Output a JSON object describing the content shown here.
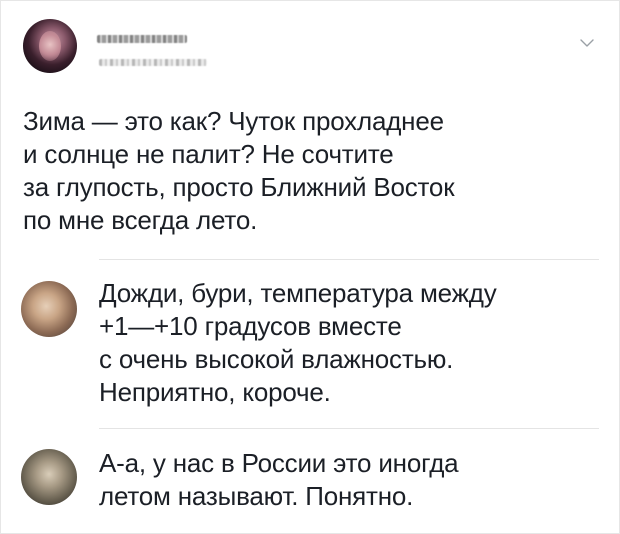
{
  "post": {
    "text": "Зима — это как? Чуток прохладнее\nи солнце не палит? Не сочтите\nза глупость, просто Ближний Восток\nпо мне всегда лето.",
    "menu_icon": "chevron-down-icon"
  },
  "replies": [
    {
      "text": "Дожди, бури, температура между\n+1—+10 градусов вместе\nс очень высокой влажностью.\nНеприятно, короче."
    },
    {
      "text": "А-а, у нас в России это иногда\nлетом называют. Понятно."
    }
  ],
  "colors": {
    "text": "#1b1f26",
    "divider": "#e4e4e4",
    "chevron": "#9aa0a6"
  }
}
